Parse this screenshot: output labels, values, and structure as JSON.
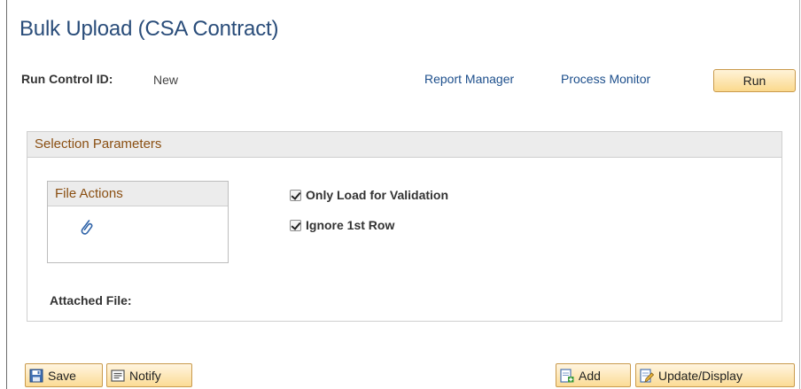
{
  "page": {
    "title": "Bulk Upload (CSA Contract)"
  },
  "run_control": {
    "label": "Run Control ID:",
    "value": "New"
  },
  "links": {
    "report_manager": "Report Manager",
    "process_monitor": "Process Monitor"
  },
  "run_button": "Run",
  "selection": {
    "header": "Selection Parameters",
    "file_actions": {
      "header": "File Actions",
      "icon": "paperclip-icon"
    },
    "checkboxes": [
      {
        "label": "Only Load for Validation",
        "checked": true
      },
      {
        "label": "Ignore 1st Row",
        "checked": true
      }
    ],
    "attached_file_label": "Attached File:"
  },
  "toolbar": {
    "save": "Save",
    "notify": "Notify",
    "add": "Add",
    "update_display": "Update/Display"
  },
  "colors": {
    "title": "#2a4d7a",
    "link": "#1d4f8c",
    "group_header_text": "#8a4f12",
    "button_top": "#fff3d8",
    "button_bottom": "#fbd98d",
    "button_border": "#c99a4c"
  }
}
